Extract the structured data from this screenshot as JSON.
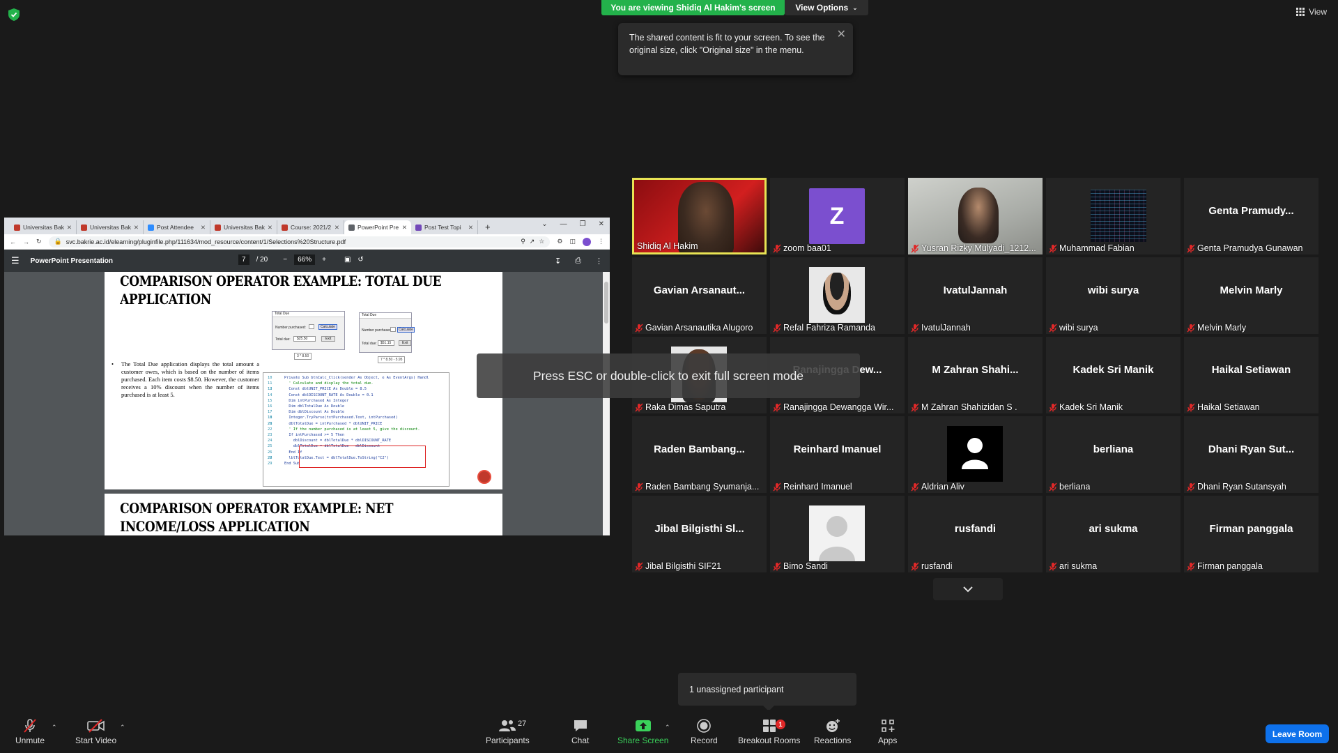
{
  "banner": {
    "viewing": "You are viewing Shidiq Al Hakim's screen",
    "view_options": "View Options",
    "view_label": "View"
  },
  "tooltip": {
    "text": "The shared content is fit to your screen. To see the original size, click \"Original size\" in the menu."
  },
  "browser": {
    "tabs": [
      {
        "label": "Universitas Bakr",
        "color": "#c0392b"
      },
      {
        "label": "Universitas Bakr",
        "color": "#c0392b"
      },
      {
        "label": "Post Attendee",
        "color": "#2d8cff"
      },
      {
        "label": "Universitas Bakr",
        "color": "#c0392b"
      },
      {
        "label": "Course: 2021/2",
        "color": "#c0392b"
      },
      {
        "label": "PowerPoint Pre",
        "color": "#5f6368"
      },
      {
        "label": "Post Test Topi",
        "color": "#7248b9"
      }
    ],
    "url": "svc.bakrie.ac.id/elearning/pluginfile.php/111634/mod_resource/content/1/Selections%20Structure.pdf",
    "pdf_title": "PowerPoint Presentation",
    "page_current": "7",
    "page_total": "/ 20",
    "zoom": "66%"
  },
  "slides": {
    "slide1_title_line1": "Comparison Operator Example: Total Due",
    "slide1_title_line2": "Application",
    "bullet": "The Total Due application displays the total amount a customer owes, which is based on the number of items purchased. Each item costs $8.50. However, the customer receives a 10% discount when the number of items purchased is at least 5.",
    "form_title": "Total Due",
    "form_field1": "Number purchased:",
    "form_field2": "Total due:",
    "form_btn1": "Calculate",
    "form_btn2": "Exit",
    "form_value1a": "$25.50",
    "form_value1b": "$51.15",
    "caption1": "3 * 8.50",
    "caption2": "7 * 8.50 - 5.95",
    "code_lines": [
      "Private Sub btnCalc_Click(sender As Object, e As EventArgs) Handl",
      "  ' Calculate and display the total due.",
      "",
      "  Const dblUNIT_PRICE As Double = 8.5",
      "  Const dblDISCOUNT_RATE As Double = 0.1",
      "  Dim intPurchased As Integer",
      "  Dim dblTotalDue As Double",
      "  Dim dblDiscount As Double",
      "",
      "  Integer.TryParse(txtPurchased.Text, intPurchased)",
      "",
      "  dblTotalDue = intPurchased * dblUNIT_PRICE",
      "  ' If the number purchased is at least 5, give the discount.",
      "  If intPurchased >= 5 Then",
      "    dblDiscount = dblTotalDue * dblDISCOUNT_RATE",
      "    dblTotalDue = dblTotalDue - dblDiscount",
      "  End If",
      "",
      "  lblTotalDue.Text = dblTotalDue.ToString(\"C2\")",
      "End Sub"
    ],
    "code_line_numbers": [
      "10",
      "11",
      "12",
      "13",
      "14",
      "15",
      "16",
      "17",
      "18",
      "19",
      "20",
      "21",
      "22",
      "23",
      "24",
      "25",
      "26",
      "27",
      "28",
      "29"
    ],
    "slide2_title_line1": "Comparison Operator Example: Net",
    "slide2_title_line2": "Income/Loss Application"
  },
  "participants": [
    {
      "tile_name": "",
      "label": "Shidiq Al Hakim",
      "type": "video-red",
      "muted": false,
      "active": true
    },
    {
      "tile_name": "",
      "label": "zoom baa01",
      "type": "letter",
      "letter": "Z",
      "muted": true
    },
    {
      "tile_name": "",
      "label": "Yusran Rizky Mulyadi_1212...",
      "type": "video-room",
      "muted": true
    },
    {
      "tile_name": "",
      "label": "Muhammad Fabian",
      "type": "image-code",
      "muted": true
    },
    {
      "tile_name": "Genta  Pramudy...",
      "label": "Genta Pramudya Gunawan",
      "type": "name",
      "muted": true
    },
    {
      "tile_name": "Gavian  Arsanaut...",
      "label": "Gavian Arsanautika Alugoro",
      "type": "name",
      "muted": true
    },
    {
      "tile_name": "",
      "label": "Refal Fahriza Ramanda",
      "type": "image-mask",
      "muted": true
    },
    {
      "tile_name": "IvatulJannah",
      "label": "IvatulJannah",
      "type": "name",
      "muted": true
    },
    {
      "tile_name": "wibi surya",
      "label": "wibi surya",
      "type": "name",
      "muted": true
    },
    {
      "tile_name": "Melvin Marly",
      "label": "Melvin Marly",
      "type": "name",
      "muted": true
    },
    {
      "tile_name": "",
      "label": "Raka Dimas Saputra",
      "type": "image-person",
      "muted": true
    },
    {
      "tile_name": "Ranajingga  Dew...",
      "label": "Ranajingga Dewangga Wir...",
      "type": "name",
      "muted": true
    },
    {
      "tile_name": "M  Zahran  Shahi...",
      "label": "M Zahran Shahizidan S .",
      "type": "name",
      "muted": true
    },
    {
      "tile_name": "Kadek Sri Manik",
      "label": "Kadek Sri Manik",
      "type": "name",
      "muted": true
    },
    {
      "tile_name": "Haikal Setiawan",
      "label": "Haikal Setiawan",
      "type": "name",
      "muted": true
    },
    {
      "tile_name": "Raden  Bambang...",
      "label": "Raden Bambang Syumanja...",
      "type": "name",
      "muted": true
    },
    {
      "tile_name": "Reinhard Imanuel",
      "label": "Reinhard Imanuel",
      "type": "name",
      "muted": true
    },
    {
      "tile_name": "",
      "label": "Aldrian Aliv",
      "type": "generic-dark",
      "muted": true
    },
    {
      "tile_name": "berliana",
      "label": "berliana",
      "type": "name",
      "muted": true
    },
    {
      "tile_name": "Dhani  Ryan  Sut...",
      "label": "Dhani Ryan Sutansyah",
      "type": "name",
      "muted": true
    },
    {
      "tile_name": "Jibal  Bilgisthi  Sl...",
      "label": "Jibal Bilgisthi SIF21",
      "type": "name",
      "muted": true
    },
    {
      "tile_name": "",
      "label": "Bimo Sandi",
      "type": "generic-light",
      "muted": true
    },
    {
      "tile_name": "rusfandi",
      "label": "rusfandi",
      "type": "name",
      "muted": true
    },
    {
      "tile_name": "ari sukma",
      "label": "ari sukma",
      "type": "name",
      "muted": true
    },
    {
      "tile_name": "Firman panggala",
      "label": "Firman panggala",
      "type": "name",
      "muted": true
    }
  ],
  "overlays": {
    "fullscreen_hint": "Press ESC or double-click to exit full screen mode",
    "unassigned": "1 unassigned participant"
  },
  "toolbar": {
    "unmute": "Unmute",
    "start_video": "Start Video",
    "participants": "Participants",
    "participants_count": "27",
    "chat": "Chat",
    "share_screen": "Share Screen",
    "record": "Record",
    "breakout_rooms": "Breakout Rooms",
    "breakout_badge": "1",
    "reactions": "Reactions",
    "apps": "Apps",
    "leave": "Leave Room"
  },
  "colors": {
    "banner_green": "#23b24b",
    "leave_blue": "#0e71eb",
    "active_speaker": "#e8e354",
    "muted_red": "#e02828",
    "share_green": "#3ad15a"
  }
}
